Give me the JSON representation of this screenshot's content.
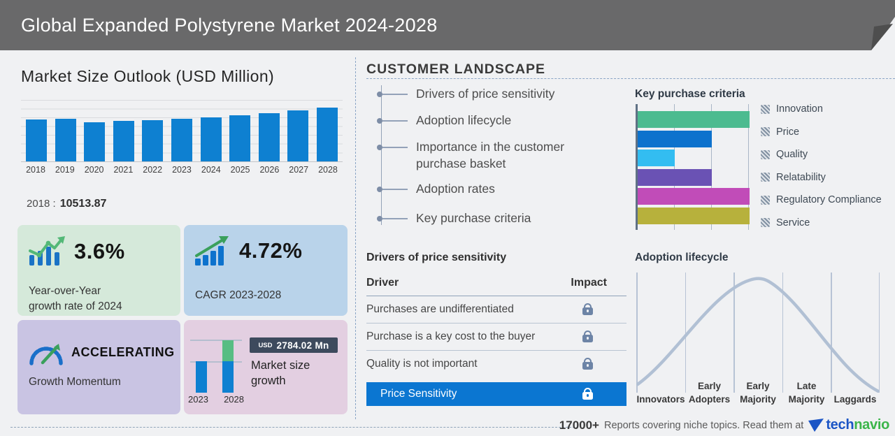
{
  "header": {
    "title": "Global Expanded Polystyrene Market 2024-2028"
  },
  "market_size_outlook": {
    "title": "Market Size Outlook (USD Million)",
    "base_year_label": "2018 :",
    "base_year_value": "10513.87"
  },
  "chart_data": [
    {
      "id": "market_size_outlook",
      "type": "bar",
      "title": "Market Size Outlook (USD Million)",
      "ylabel": "USD Million",
      "categories": [
        "2018",
        "2019",
        "2020",
        "2021",
        "2022",
        "2023",
        "2024",
        "2025",
        "2026",
        "2027",
        "2028"
      ],
      "values": [
        10513.87,
        10760,
        9940,
        10230,
        10460,
        10800,
        11190,
        11630,
        12200,
        12950,
        13590
      ],
      "bar_color": "#0e80d1",
      "grid": true,
      "axis_max": 15500
    },
    {
      "id": "key_purchase_criteria",
      "type": "bar",
      "orientation": "horizontal",
      "title": "Key purchase criteria",
      "categories": [
        "Innovation",
        "Price",
        "Quality",
        "Relatability",
        "Regulatory Compliance",
        "Service"
      ],
      "values_pct": [
        100,
        66,
        33,
        66,
        100,
        100
      ],
      "colors": [
        "#4cbb90",
        "#0d72cd",
        "#33bdf1",
        "#6a52b4",
        "#c14cb8",
        "#b7b13c"
      ],
      "legend_position": "right",
      "grid": true
    },
    {
      "id": "market_size_growth",
      "type": "bar",
      "title": "Market size growth",
      "categories": [
        "2023",
        "2028"
      ],
      "growth_usd_mn": 2784.02,
      "note": "2028 bar equals 2023 bar plus green growth segment of USD 2784.02 Mn",
      "colors": {
        "base": "#0e80d1",
        "growth": "#57bd83"
      }
    },
    {
      "id": "adoption_lifecycle",
      "type": "area",
      "title": "Adoption lifecycle",
      "curve": "bell",
      "peak_stage": "Early Majority",
      "categories": [
        "Innovators",
        "Early Adopters",
        "Early Majority",
        "Late Majority",
        "Laggards"
      ]
    }
  ],
  "stat_boxes": {
    "yoy": {
      "value": "3.6%",
      "line1": "Year-over-Year",
      "line2": "growth rate of 2024",
      "bg": "#d5e9da"
    },
    "cagr": {
      "value": "4.72%",
      "label": "CAGR 2023-2028",
      "bg": "#b9d3ea"
    },
    "momentum": {
      "status": "ACCELERATING",
      "label": "Growth Momentum",
      "bg": "#c9c4e3"
    },
    "growth": {
      "currency": "USD",
      "amount": "2784.02 Mn",
      "line1": "Market size",
      "line2": "growth",
      "year_left": "2023",
      "year_right": "2028",
      "bg": "#e3cfe1"
    }
  },
  "customer_landscape": {
    "title": "CUSTOMER LANDSCAPE",
    "items": [
      "Drivers of price sensitivity",
      "Adoption lifecycle",
      "Importance in the customer purchase basket",
      "Adoption rates",
      "Key purchase criteria"
    ]
  },
  "key_purchase_criteria": {
    "title": "Key purchase criteria"
  },
  "drivers_table": {
    "title": "Drivers of price sensitivity",
    "columns": [
      "Driver",
      "Impact"
    ],
    "rows": [
      "Purchases are undifferentiated",
      "Purchase is a key cost to the buyer",
      "Quality is not important"
    ],
    "highlight_row": "Price Sensitivity",
    "highlight_color": "#0b76d1"
  },
  "adoption_lifecycle": {
    "title": "Adoption lifecycle",
    "stages": [
      [
        "Innovators"
      ],
      [
        "Early",
        "Adopters"
      ],
      [
        "Early",
        "Majority"
      ],
      [
        "Late",
        "Majority"
      ],
      [
        "Laggards"
      ]
    ]
  },
  "footer": {
    "count": "17000+",
    "text": "Reports covering niche topics. Read them at",
    "brand": {
      "part1": "tech",
      "part2": "navio"
    }
  },
  "colors": {
    "header_bg": "#69696a",
    "page_bg": "#f0f1f3",
    "primary_bar_blue": "#0e80d1",
    "highlight_blue": "#0b76d1",
    "growth_green": "#57bd83",
    "badge_navy": "#3d4a5d",
    "curve_gray_blue": "#b1c0d4",
    "dashed_line": "#8aa5c6",
    "brand_blue": "#1b55c5",
    "brand_green": "#3bb54a"
  }
}
